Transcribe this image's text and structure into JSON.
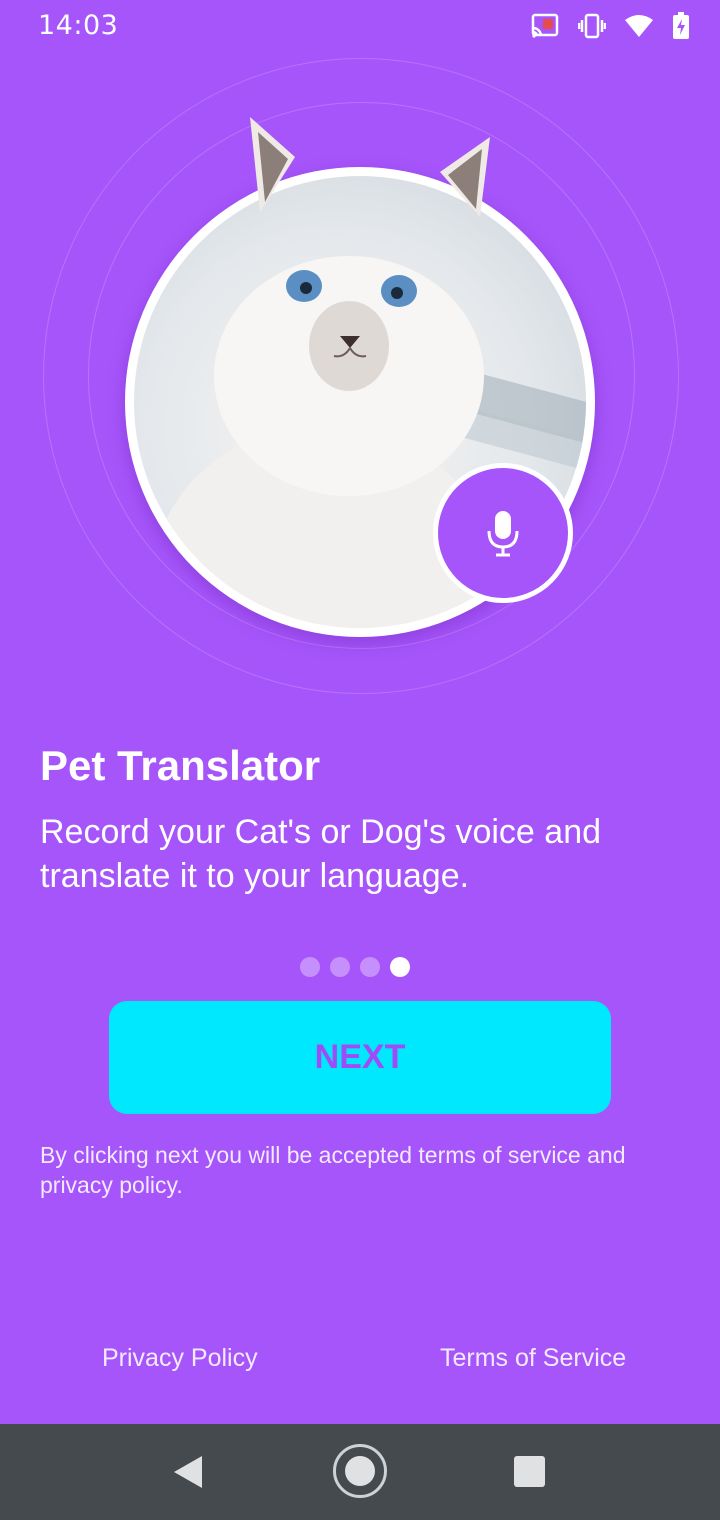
{
  "status_bar": {
    "time": "14:03",
    "icons": [
      "cast-icon",
      "vibrate-icon",
      "wifi-icon",
      "battery-charging-icon"
    ]
  },
  "hero": {
    "photo": "cat-photo",
    "mic_icon": "microphone-icon"
  },
  "onboarding": {
    "title": "Pet Translator",
    "description": "Record your Cat's or Dog's voice and translate it to your language.",
    "page_count": 4,
    "current_page": 4
  },
  "next_button": {
    "label": "NEXT"
  },
  "consent_text": "By clicking next you will be accepted terms of service and privacy policy.",
  "footer": {
    "privacy_label": "Privacy Policy",
    "terms_label": "Terms of Service"
  },
  "colors": {
    "background": "#A655FA",
    "button": "#00E8FE",
    "button_text": "#A04CF6",
    "nav_bar": "#454A4F"
  },
  "nav_bar": {
    "buttons": [
      "back-icon",
      "home-icon",
      "recents-icon"
    ]
  }
}
